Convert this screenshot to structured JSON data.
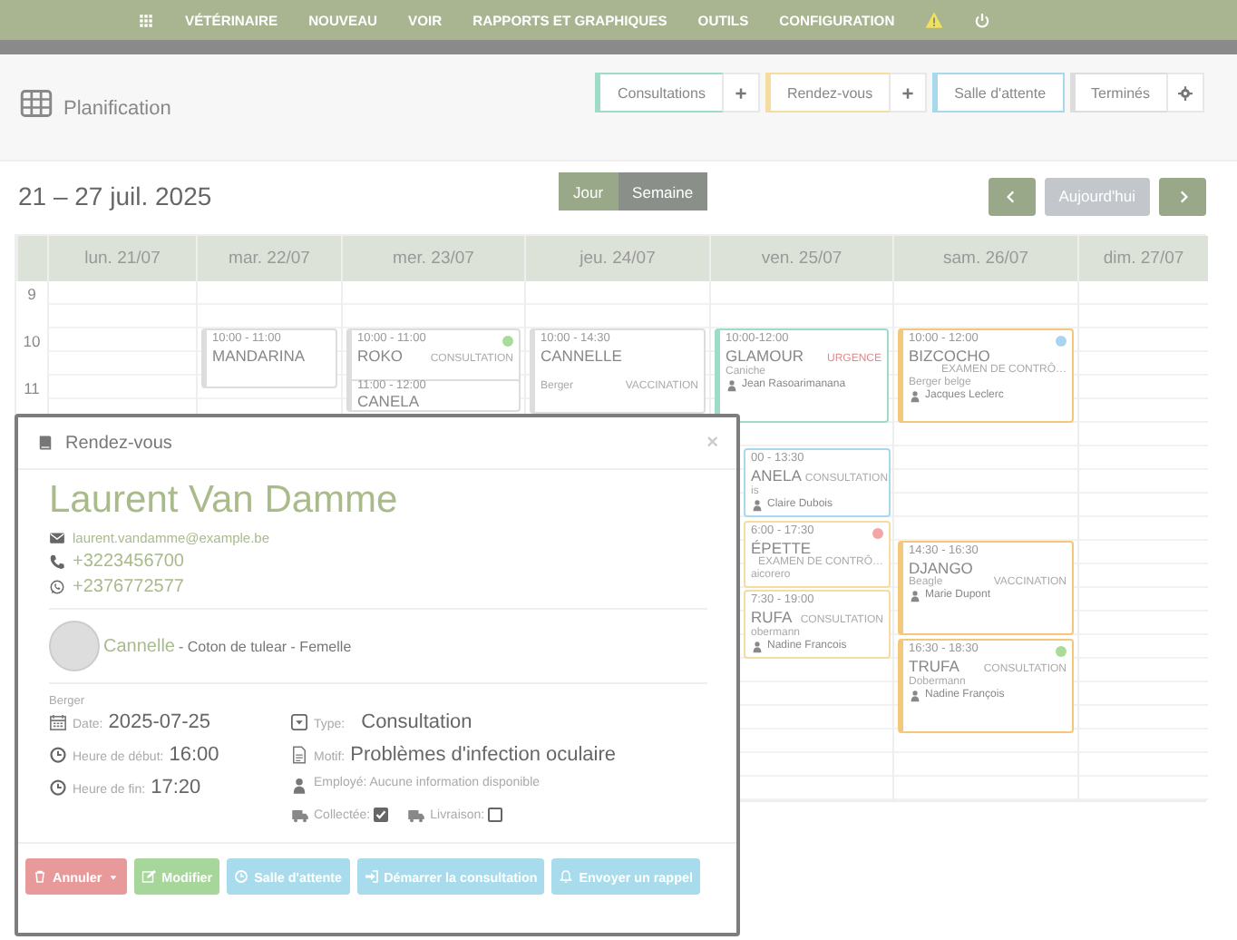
{
  "nav": {
    "items": [
      "VÉTÉRINAIRE",
      "NOUVEAU",
      "VOIR",
      "RAPPORTS ET GRAPHIQUES",
      "OUTILS",
      "CONFIGURATION"
    ]
  },
  "header": {
    "title": "Planification",
    "buttons": [
      {
        "label": "Consultations",
        "color": "#9fdcc8",
        "kind": "add"
      },
      {
        "label": "Rendez-vous",
        "color": "#f5dca0",
        "kind": "add"
      },
      {
        "label": "Salle d'attente",
        "color": "#a8d8ec",
        "kind": "plain"
      },
      {
        "label": "Terminés",
        "color": "#dddddd",
        "kind": "settings"
      }
    ]
  },
  "toolbar": {
    "range": "21 – 27 juil. 2025",
    "views": [
      {
        "label": "Jour",
        "selected": false
      },
      {
        "label": "Semaine",
        "selected": true
      }
    ],
    "today": {
      "label": "Aujourd'hui",
      "disabled": true
    }
  },
  "calendar": {
    "hours": [
      "9",
      "10",
      "11"
    ],
    "days": [
      {
        "label": "lun. 21/07"
      },
      {
        "label": "mar. 22/07",
        "events": [
          {
            "time": "10:00 - 11:00",
            "name": "MANDARINA",
            "color": "#dddddd"
          }
        ]
      },
      {
        "label": "mer. 23/07",
        "events": [
          {
            "time": "10:00 - 11:00",
            "name": "ROKO",
            "type": "CONSULTATION",
            "color": "#dddddd",
            "status": {
              "color": "#a8dc98"
            }
          },
          {
            "time": "11:00 - 12:00",
            "name": "CANELA",
            "color": "#dddddd"
          }
        ]
      },
      {
        "label": "jeu. 24/07",
        "events": [
          {
            "time": "10:00 - 14:30",
            "name": "CANNELLE",
            "breed": "Berger",
            "type": "VACCINATION",
            "color": "#dddddd"
          }
        ]
      },
      {
        "label": "ven. 25/07",
        "events": [
          {
            "time": "10:00-12:00",
            "name": "GLAMOUR",
            "type": "URGENCE",
            "urgent": true,
            "breed": "Caniche",
            "owner": "Jean Rasoarimanana",
            "color": "#9fdcc8"
          },
          {
            "time": "00 - 13:30",
            "name": "ANELA",
            "type": "CONSULTATION",
            "urgent": false,
            "breed": "is",
            "owner": "Claire Dubois",
            "color": "#a8d8ec"
          },
          {
            "time": "6:00 - 17:30",
            "name": "ÉPETTE",
            "type": "EXAMEN DE CONTRÔ…",
            "urgent": false,
            "breed": "aicorero",
            "color": "#f5dca0",
            "status": {
              "color": "#f4a6a6"
            }
          },
          {
            "time": "7:30 - 19:00",
            "name": "RUFA",
            "type": "CONSULTATION",
            "urgent": false,
            "breed": "obermann",
            "owner": "Nadine Francois",
            "color": "#f5dca0"
          }
        ]
      },
      {
        "label": "sam. 26/07",
        "events": [
          {
            "time": "10:00 - 12:00",
            "name": "BIZCOCHO",
            "type": "EXAMEN DE CONTRÔ…",
            "breed": "Berger belge",
            "owner": "Jacques Leclerc",
            "color": "#f5c77a",
            "status": {
              "color": "#a8d4f0"
            }
          },
          {
            "time": "14:30 - 16:30",
            "name": "DJANGO",
            "breed": "Beagle",
            "type": "VACCINATION",
            "owner": "Marie Dupont",
            "color": "#f5c77a"
          },
          {
            "time": "16:30 - 18:30",
            "name": "TRUFA",
            "type": "CONSULTATION",
            "breed": "Dobermann",
            "owner": "Nadine François",
            "color": "#f5c77a",
            "status": {
              "color": "#a8dc98"
            }
          }
        ]
      },
      {
        "label": "dim. 27/07"
      }
    ]
  },
  "modal": {
    "title": "Rendez-vous",
    "close": "×",
    "client": "Laurent Van Damme",
    "email": "laurent.vandamme@example.be",
    "phone": "+3223456700",
    "whatsapp": "+2376772577",
    "pet": {
      "name": "Cannelle",
      "details": "- Coton de tulear - Femelle",
      "breed": "Berger"
    },
    "fields": [
      {
        "label": "Date:",
        "value": "2025-07-25"
      },
      {
        "label": "Heure de début:",
        "value": "16:00"
      },
      {
        "label": "Heure de fin:",
        "value": "17:20"
      }
    ],
    "type": {
      "label": "Type:",
      "value": "Consultation"
    },
    "motif": {
      "label": "Motif:",
      "value": "Problèmes d'infection oculaire"
    },
    "employee": "Employé: Aucune information disponible",
    "checks": [
      {
        "label": "Collectée:",
        "checked": true
      },
      {
        "label": "Livraison:",
        "checked": false
      }
    ],
    "buttons": [
      {
        "label": "Annuler",
        "kind": "danger"
      },
      {
        "label": "Modifier",
        "kind": "success"
      },
      {
        "label": "Salle d'attente",
        "kind": "info"
      },
      {
        "label": "Démarrer la consultation",
        "kind": "info"
      },
      {
        "label": "Envoyer un rappel",
        "kind": "info"
      }
    ]
  }
}
